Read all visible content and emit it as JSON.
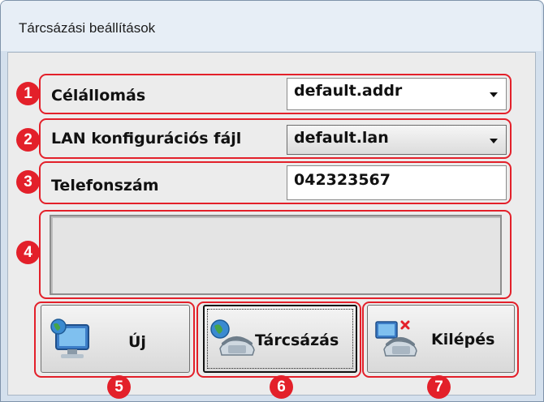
{
  "window": {
    "title": "Tárcsázási beállítások"
  },
  "fields": {
    "target": {
      "badge": "1",
      "label": "Célállomás",
      "value": "default.addr"
    },
    "lan": {
      "badge": "2",
      "label": "LAN konfigurációs fájl",
      "value": "default.lan"
    },
    "phone": {
      "badge": "3",
      "label": "Telefonszám",
      "value": "042323567"
    }
  },
  "message_area": {
    "badge": "4",
    "text": ""
  },
  "buttons": {
    "new": {
      "badge": "5",
      "label": "Új",
      "icon": "computer-globe-icon"
    },
    "dial": {
      "badge": "6",
      "label": "Tárcsázás",
      "icon": "globe-phone-icon"
    },
    "exit": {
      "badge": "7",
      "label": "Kilépés",
      "icon": "computer-phone-disconnect-icon"
    }
  },
  "colors": {
    "annotation_red": "#e3202a",
    "window_bg": "#ececec",
    "title_bar": "#e7eef6"
  }
}
